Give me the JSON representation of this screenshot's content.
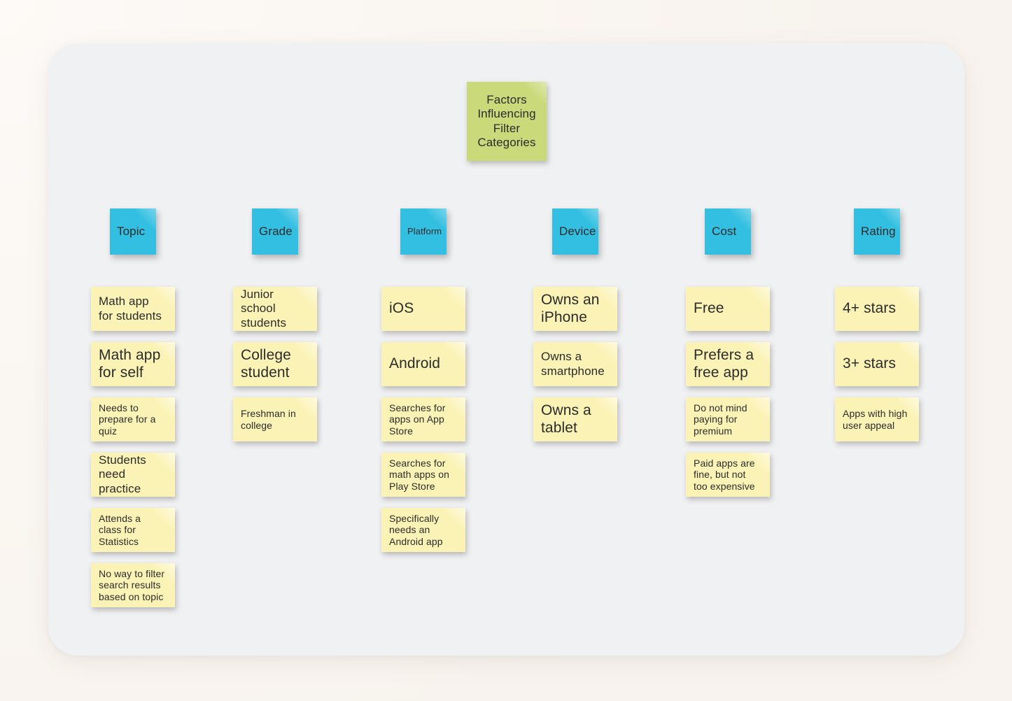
{
  "board": {
    "title_note": {
      "label": "Factors\nInfluencing\nFilter\nCategories",
      "color": "#cada7a"
    },
    "colors": {
      "page_background": "#faf6f2",
      "canvas": "#f0f1f2",
      "green_note": "#cada7a",
      "blue_note": "#33bfe1",
      "yellow_note": "#fbf3b6",
      "text": "#2b2b2b"
    },
    "columns": [
      {
        "category": "Topic",
        "category_size": "md",
        "notes": [
          {
            "text": "Math app\nfor students",
            "size": "md"
          },
          {
            "text": "Math app\nfor self",
            "size": "lg"
          },
          {
            "text": "Needs to\nprepare for a\nquiz",
            "size": "sm"
          },
          {
            "text": "Students\nneed practice",
            "size": "md"
          },
          {
            "text": "Attends a\nclass for\nStatistics",
            "size": "sm"
          },
          {
            "text": "No way to filter\nsearch results\nbased on topic",
            "size": "sm"
          }
        ]
      },
      {
        "category": "Grade",
        "category_size": "md",
        "notes": [
          {
            "text": "Junior school\nstudents",
            "size": "md"
          },
          {
            "text": "College\nstudent",
            "size": "lg"
          },
          {
            "text": "Freshman in\ncollege",
            "size": "sm"
          }
        ]
      },
      {
        "category": "Platform",
        "category_size": "xs",
        "notes": [
          {
            "text": "iOS",
            "size": "lg"
          },
          {
            "text": "Android",
            "size": "lg"
          },
          {
            "text": "Searches for\napps on App\nStore",
            "size": "sm"
          },
          {
            "text": "Searches for\nmath apps on\nPlay Store",
            "size": "sm"
          },
          {
            "text": "Specifically\nneeds an\nAndroid app",
            "size": "sm"
          }
        ]
      },
      {
        "category": "Device",
        "category_size": "md",
        "notes": [
          {
            "text": "Owns an\niPhone",
            "size": "lg"
          },
          {
            "text": "Owns a\nsmartphone",
            "size": "md"
          },
          {
            "text": "Owns a\ntablet",
            "size": "lg"
          }
        ]
      },
      {
        "category": "Cost",
        "category_size": "md",
        "notes": [
          {
            "text": "Free",
            "size": "lg"
          },
          {
            "text": "Prefers a\nfree app",
            "size": "lg"
          },
          {
            "text": "Do not mind\npaying for\npremium",
            "size": "sm"
          },
          {
            "text": "Paid apps are\nfine, but not\ntoo expensive",
            "size": "sm"
          }
        ]
      },
      {
        "category": "Rating",
        "category_size": "md",
        "notes": [
          {
            "text": "4+ stars",
            "size": "lg"
          },
          {
            "text": "3+ stars",
            "size": "lg"
          },
          {
            "text": "Apps with high\nuser appeal",
            "size": "sm"
          }
        ]
      }
    ]
  }
}
